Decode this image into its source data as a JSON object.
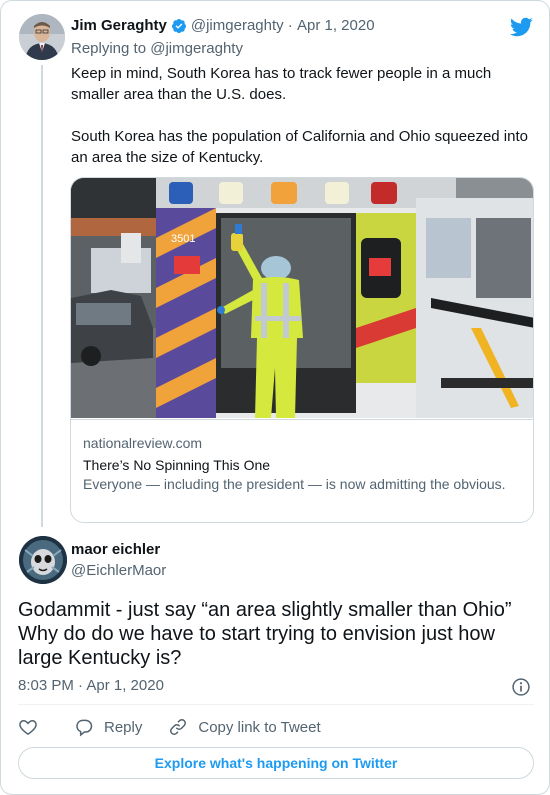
{
  "parent_tweet": {
    "display_name": "Jim Geraghty",
    "handle": "@jimgeraghty",
    "date": "Apr 1, 2020",
    "replying_to": "Replying to @jimgeraghty",
    "text_paragraphs": [
      "Keep in mind, South Korea has to track fewer people in a much smaller area than the U.S. does.",
      "South Korea has the population of California and Ohio squeezed into an area the size of Kentucky."
    ],
    "link_card": {
      "domain": "nationalreview.com",
      "title": "There’s No Spinning This One",
      "description": "Everyone — including the president — is now admitting the obvious.",
      "image_text": "3501"
    }
  },
  "main_tweet": {
    "display_name": "maor eichler",
    "handle": "@EichlerMaor",
    "text": "Godammit - just say “an area slightly smaller than Ohio” Why do do we have to start trying to envision just how large Kentucky is?",
    "timestamp": "8:03 PM · Apr 1, 2020"
  },
  "actions": {
    "reply_label": "Reply",
    "copy_link_label": "Copy link to Tweet"
  },
  "explore_button": "Explore what's happening on Twitter",
  "colors": {
    "twitter_blue": "#1d9bf0",
    "muted_text": "#536471",
    "border": "#cfd9de"
  },
  "icons": [
    "verified-badge-icon",
    "twitter-bird-icon",
    "info-icon",
    "heart-icon",
    "reply-icon",
    "link-icon"
  ]
}
